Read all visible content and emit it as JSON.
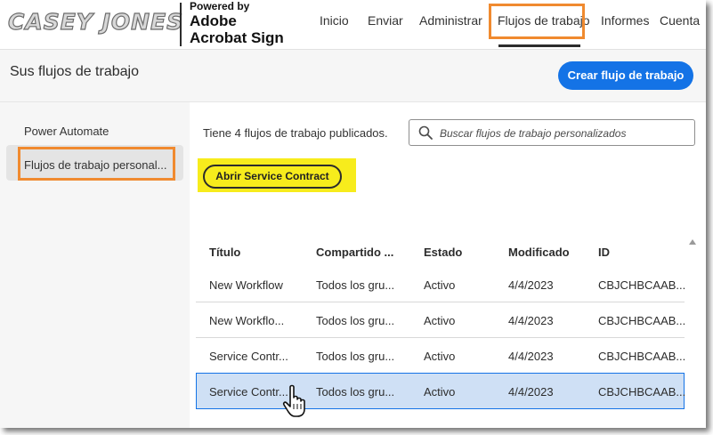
{
  "header": {
    "brand": "CASEY JONES",
    "powered_by": "Powered by",
    "product_line1": "Adobe",
    "product_line2": "Acrobat Sign",
    "nav": [
      "Inicio",
      "Enviar",
      "Administrar",
      "Flujos de trabajo",
      "Informes",
      "Cuenta"
    ],
    "active_nav": "Flujos de trabajo"
  },
  "titlebar": {
    "title": "Sus flujos de trabajo",
    "create_button": "Crear flujo de trabajo"
  },
  "sidebar": {
    "items": [
      "Power Automate",
      "Flujos de trabajo personal..."
    ],
    "selected": "Flujos de trabajo personal..."
  },
  "main": {
    "count_text": "Tiene 4 flujos de trabajo publicados.",
    "search_placeholder": "Buscar flujos de trabajo personalizados",
    "open_button": "Abrir Service Contract"
  },
  "table": {
    "columns": [
      "Título",
      "Compartido ...",
      "Estado",
      "Modificado",
      "ID"
    ],
    "rows": [
      [
        "New Workflow",
        "Todos los gru...",
        "Activo",
        "4/4/2023",
        "CBJCHBCAAB..."
      ],
      [
        "New Workflo...",
        "Todos los gru...",
        "Activo",
        "4/4/2023",
        "CBJCHBCAAB..."
      ],
      [
        "Service Contr...",
        "Todos los gru...",
        "Activo",
        "4/4/2023",
        "CBJCHBCAAB..."
      ],
      [
        "Service Contr...",
        "Todos los gru...",
        "Activo",
        "4/4/2023",
        "CBJCHBCAAB..."
      ]
    ],
    "selected_row": 4
  },
  "colors": {
    "accent_blue": "#1473e6",
    "highlight_orange": "#f08a2f",
    "highlight_yellow": "#f7ec1c",
    "selected_row": "#cfe0f5"
  }
}
